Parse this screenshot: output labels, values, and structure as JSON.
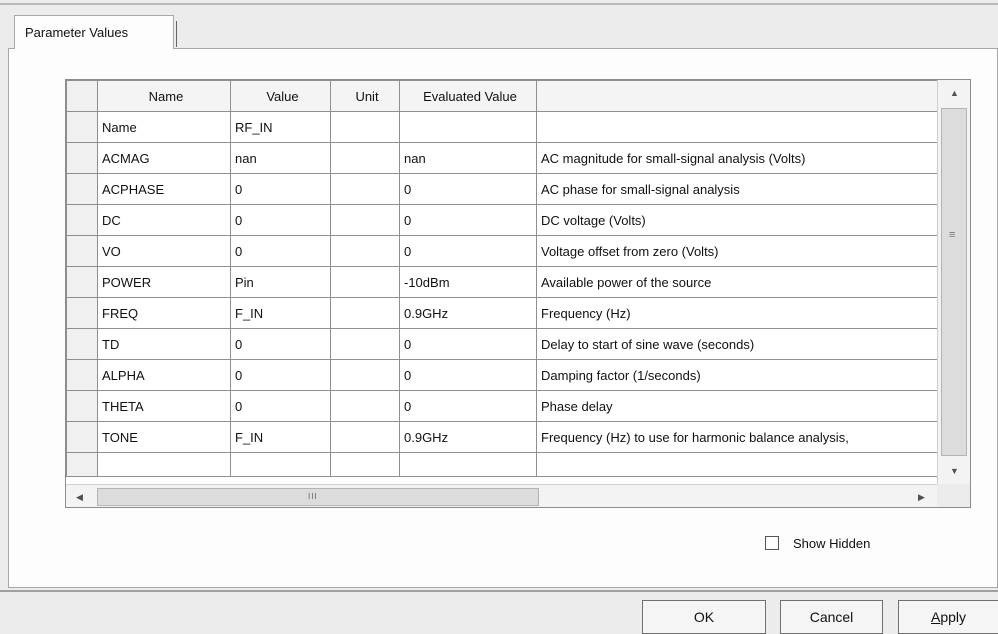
{
  "tab": {
    "label": "Parameter Values"
  },
  "grid": {
    "columns": [
      "Name",
      "Value",
      "Unit",
      "Evaluated Value",
      ""
    ],
    "rows": [
      {
        "name": "Name",
        "value": "RF_IN",
        "unit": "",
        "evaluated": "",
        "description": ""
      },
      {
        "name": "ACMAG",
        "value": "nan",
        "unit": "",
        "evaluated": "nan",
        "description": "AC magnitude for small-signal analysis (Volts)"
      },
      {
        "name": "ACPHASE",
        "value": "0",
        "unit": "",
        "evaluated": "0",
        "description": "AC phase for small-signal analysis"
      },
      {
        "name": "DC",
        "value": "0",
        "unit": "",
        "evaluated": "0",
        "description": "DC voltage (Volts)"
      },
      {
        "name": "VO",
        "value": "0",
        "unit": "",
        "evaluated": "0",
        "description": "Voltage offset from zero (Volts)"
      },
      {
        "name": "POWER",
        "value": "Pin",
        "unit": "",
        "evaluated": "-10dBm",
        "description": "Available power of the source"
      },
      {
        "name": "FREQ",
        "value": "F_IN",
        "unit": "",
        "evaluated": "0.9GHz",
        "description": "Frequency (Hz)"
      },
      {
        "name": "TD",
        "value": "0",
        "unit": "",
        "evaluated": "0",
        "description": "Delay to start of sine wave (seconds)"
      },
      {
        "name": "ALPHA",
        "value": "0",
        "unit": "",
        "evaluated": "0",
        "description": "Damping factor (1/seconds)"
      },
      {
        "name": "THETA",
        "value": "0",
        "unit": "",
        "evaluated": "0",
        "description": "Phase delay"
      },
      {
        "name": "TONE",
        "value": "F_IN",
        "unit": "",
        "evaluated": "0.9GHz",
        "description": "Frequency (Hz) to use for harmonic balance analysis,"
      }
    ]
  },
  "scrollbars": {
    "vertical_grip": "≡",
    "horizontal_grip": "III"
  },
  "show_hidden": {
    "label": "Show Hidden",
    "checked": false
  },
  "buttons": {
    "ok": "OK",
    "cancel": "Cancel",
    "apply_accel": "A",
    "apply_rest": "pply"
  }
}
